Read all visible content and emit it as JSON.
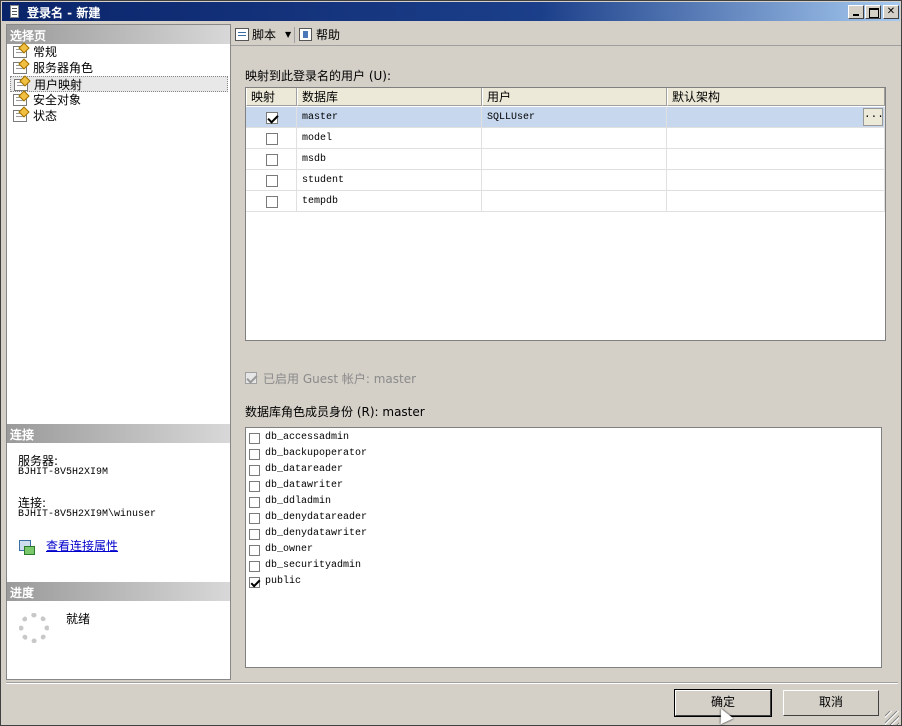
{
  "window": {
    "title": "登录名 - 新建"
  },
  "nav": {
    "header": "选择页",
    "items": [
      {
        "label": "常规",
        "selected": false
      },
      {
        "label": "服务器角色",
        "selected": false
      },
      {
        "label": "用户映射",
        "selected": true
      },
      {
        "label": "安全对象",
        "selected": false
      },
      {
        "label": "状态",
        "selected": false
      }
    ]
  },
  "connection": {
    "header": "连接",
    "server_label": "服务器:",
    "server_value": "BJHIT-8V5H2XI9M",
    "conn_label": "连接:",
    "conn_value": "BJHIT-8V5H2XI9M\\winuser",
    "link": "查看连接属性"
  },
  "progress": {
    "header": "进度",
    "status": "就绪"
  },
  "toolbar": {
    "script_label": "脚本",
    "help_label": "帮助"
  },
  "mapping": {
    "label": "映射到此登录名的用户 (U):",
    "columns": [
      "映射",
      "数据库",
      "用户",
      "默认架构"
    ],
    "rows": [
      {
        "mapped": true,
        "database": "master",
        "user": "SQLLUser",
        "schema": "",
        "selected": true
      },
      {
        "mapped": false,
        "database": "model",
        "user": "",
        "schema": ""
      },
      {
        "mapped": false,
        "database": "msdb",
        "user": "",
        "schema": ""
      },
      {
        "mapped": false,
        "database": "student",
        "user": "",
        "schema": ""
      },
      {
        "mapped": false,
        "database": "tempdb",
        "user": "",
        "schema": ""
      }
    ],
    "ellipsis": "..."
  },
  "guest": {
    "label": "已启用 Guest 帐户: master",
    "checked": true,
    "enabled": false
  },
  "roles": {
    "label": "数据库角色成员身份 (R): master",
    "items": [
      {
        "name": "db_accessadmin",
        "checked": false
      },
      {
        "name": "db_backupoperator",
        "checked": false
      },
      {
        "name": "db_datareader",
        "checked": false
      },
      {
        "name": "db_datawriter",
        "checked": false
      },
      {
        "name": "db_ddladmin",
        "checked": false
      },
      {
        "name": "db_denydatareader",
        "checked": false
      },
      {
        "name": "db_denydatawriter",
        "checked": false
      },
      {
        "name": "db_owner",
        "checked": false
      },
      {
        "name": "db_securityadmin",
        "checked": false
      },
      {
        "name": "public",
        "checked": true
      }
    ]
  },
  "buttons": {
    "ok": "确定",
    "cancel": "取消"
  }
}
